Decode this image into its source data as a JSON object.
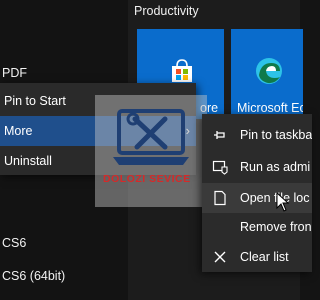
{
  "app_list": {
    "items": [
      {
        "label": "PDF"
      },
      {
        "label": "CS6"
      },
      {
        "label": "CS6 (64bit)"
      }
    ]
  },
  "tiles": {
    "group_header": "Productivity",
    "store": {
      "label": "ore",
      "color": "#0a6ccc"
    },
    "edge": {
      "label": "Microsoft Ec",
      "color": "#0a6ccc"
    }
  },
  "context_menu": {
    "items": [
      {
        "label": "Pin to Start"
      },
      {
        "label": "More",
        "selected": true
      },
      {
        "label": "Uninstall"
      }
    ]
  },
  "submenu": {
    "items": [
      {
        "label": "Pin to taskba",
        "icon": "pin-icon"
      },
      {
        "label": "Run as admi",
        "icon": "admin-shield-icon"
      },
      {
        "label": "Open file loc",
        "icon": "open-file-location-icon",
        "hovered": true
      },
      {
        "label": "Remove fron",
        "icon": ""
      },
      {
        "label": "Clear list",
        "icon": "close-icon"
      }
    ]
  },
  "watermark": {
    "text": "DOLOZI SEVICE"
  },
  "colors": {
    "accent": "#1f4f8c",
    "tile_blue": "#0a6ccc",
    "menu_bg": "#2a2a2a"
  }
}
